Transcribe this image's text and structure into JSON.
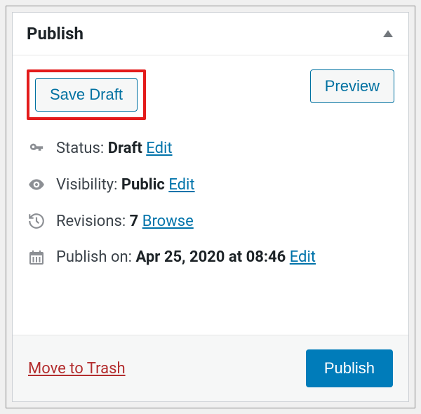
{
  "header": {
    "title": "Publish"
  },
  "actions": {
    "save_draft": "Save Draft",
    "preview": "Preview",
    "publish": "Publish",
    "move_to_trash": "Move to Trash"
  },
  "status": {
    "label": "Status:",
    "value": "Draft",
    "edit": "Edit"
  },
  "visibility": {
    "label": "Visibility:",
    "value": "Public",
    "edit": "Edit"
  },
  "revisions": {
    "label": "Revisions:",
    "value": "7",
    "browse": "Browse"
  },
  "schedule": {
    "label": "Publish on:",
    "value": "Apr 25, 2020 at 08:46",
    "edit": "Edit"
  }
}
